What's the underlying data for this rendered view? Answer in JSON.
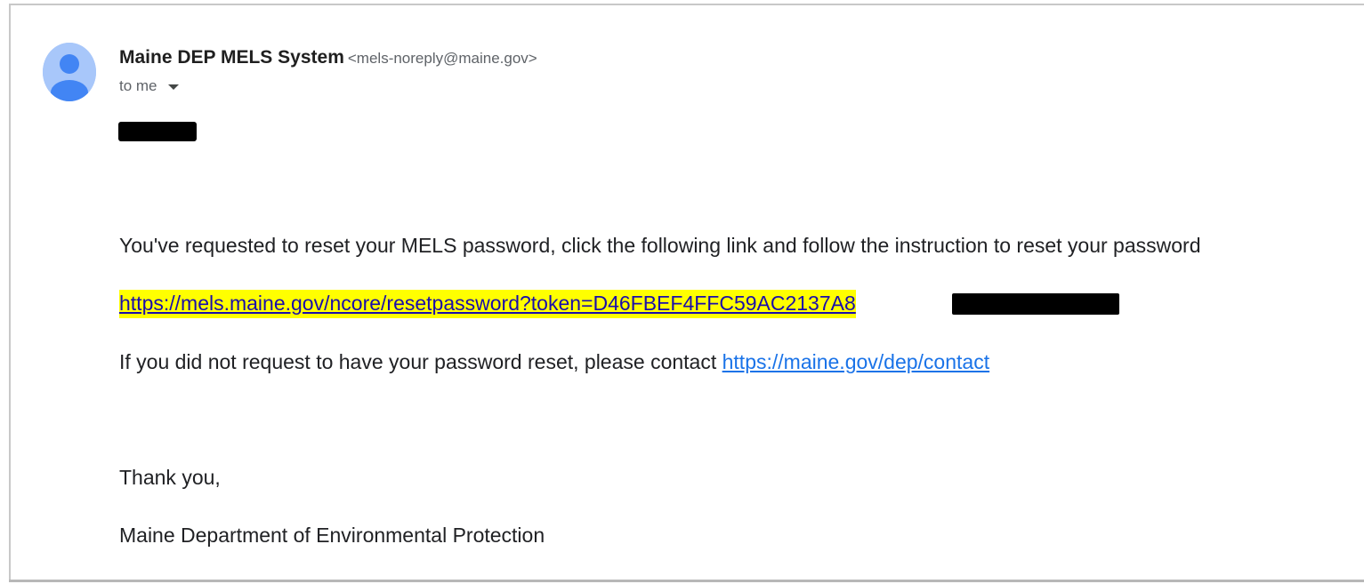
{
  "sender": {
    "name": "Maine DEP MELS System",
    "email": "<mels-noreply@maine.gov>",
    "recipient_label": "to me"
  },
  "body": {
    "intro": "You've requested to reset your MELS password, click the following link and follow the instruction to reset your password",
    "reset_link": "https://mels.maine.gov/ncore/resetpassword?token=D46FBEF4FFC59AC2137A8",
    "contact_text": "If you did not request to have your password reset, please contact ",
    "contact_link": "https://maine.gov/dep/contact",
    "thanks": "Thank you,",
    "signature": "Maine Department of Environmental Protection"
  },
  "colors": {
    "avatar_bg": "#a8c7fa",
    "avatar_fg": "#4285f4",
    "highlight": "#ffff00",
    "link": "#1a73e8"
  },
  "icons": {
    "avatar": "default-person-avatar-icon",
    "recipient_dropdown": "caret-down-icon"
  }
}
